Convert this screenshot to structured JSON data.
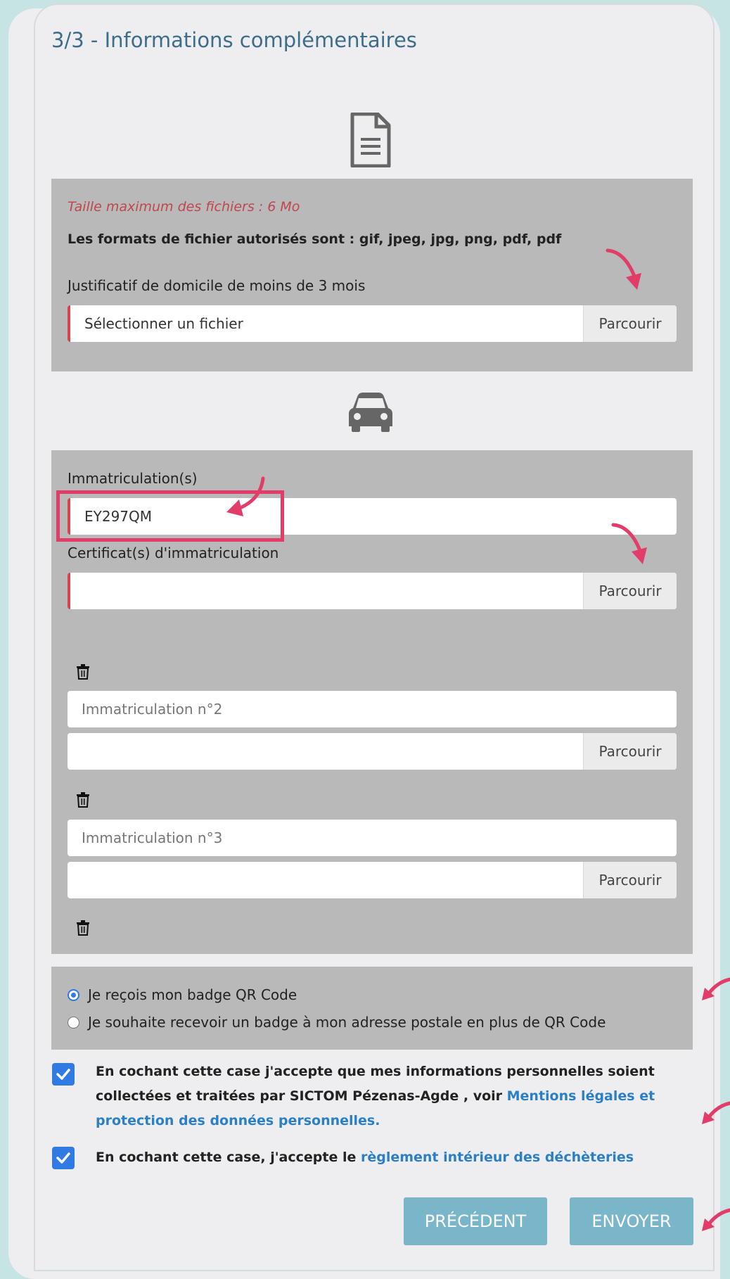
{
  "title": "3/3 - Informations complémentaires",
  "upload_section": {
    "max_size_note": "Taille maximum des fichiers : 6 Mo",
    "formats_note": "Les formats de fichier autorisés sont : gif, jpeg, jpg, png, pdf, pdf",
    "proof_label": "Justificatif de domicile de moins de 3 mois",
    "proof_placeholder": "Sélectionner un fichier",
    "browse_label": "Parcourir"
  },
  "vehicle_section": {
    "plate_label": "Immatriculation(s)",
    "plate_value": "EY297QM",
    "certificate_label": "Certificat(s) d'immatriculation",
    "plate2_placeholder": "Immatriculation n°2",
    "plate3_placeholder": "Immatriculation n°3"
  },
  "badge_options": {
    "option1": "Je reçois mon badge QR Code",
    "option2": "Je souhaite recevoir un badge à mon adresse postale en plus de QR Code",
    "selected": "option1"
  },
  "consents": {
    "c1_text": "En cochant cette case j'accepte que mes informations personnelles soient collectées et traitées par SICTOM Pézenas-Agde , voir ",
    "c1_link": "Mentions légales et protection des données personnelles.",
    "c2_text": "En cochant cette case, j'accepte le ",
    "c2_link": "règlement intérieur des déchèteries"
  },
  "buttons": {
    "previous": "PRÉCÉDENT",
    "send": "ENVOYER"
  },
  "colors": {
    "accent_blue": "#2f7be3",
    "button": "#79b6ca",
    "annotation": "#e23c69",
    "required": "#d9444c"
  }
}
